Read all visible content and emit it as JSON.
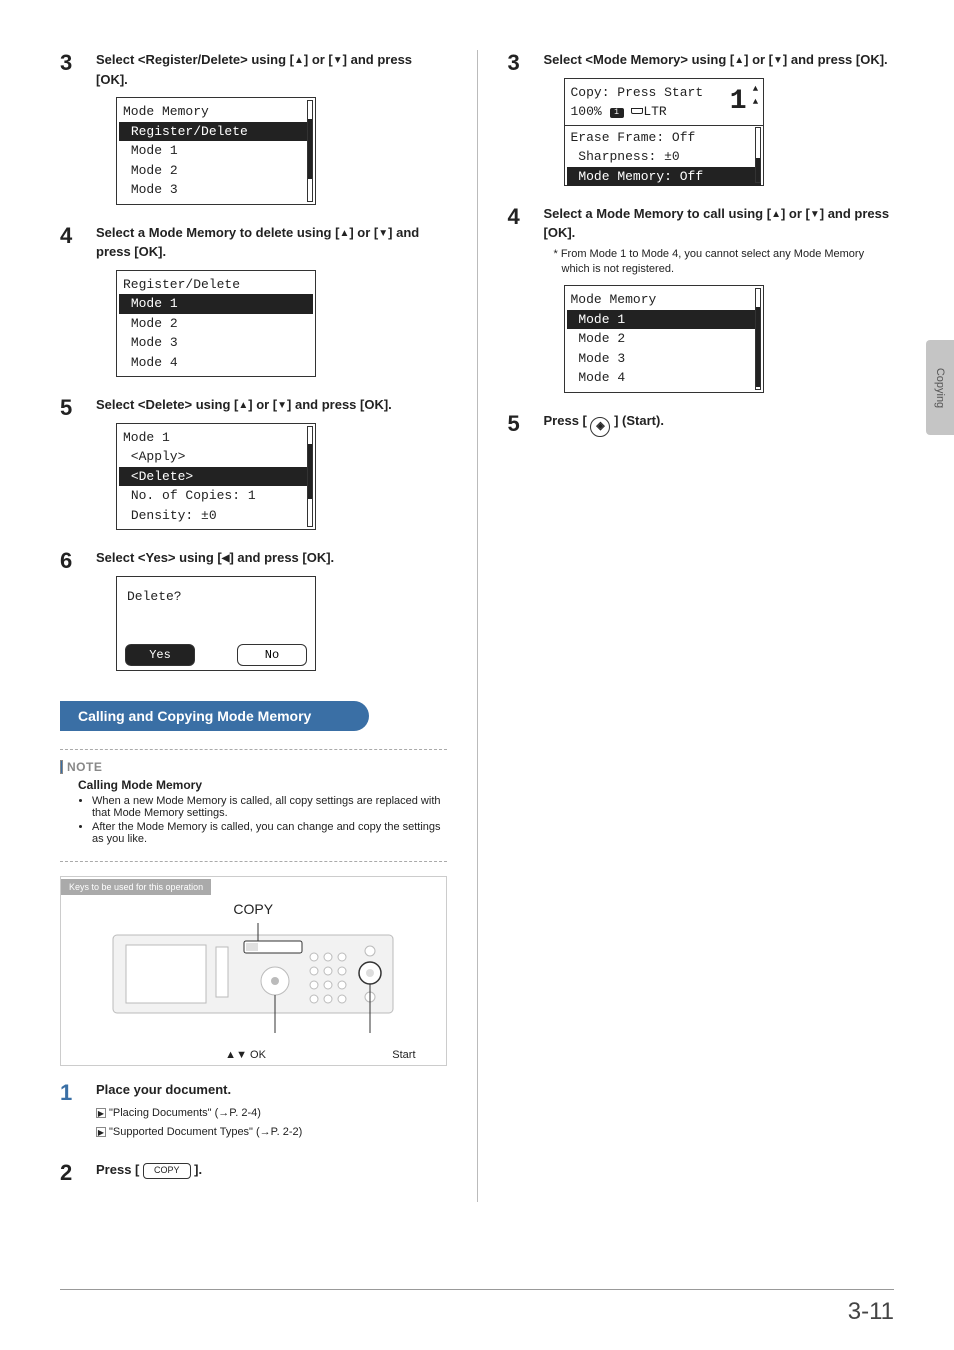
{
  "side_tab": "Copying",
  "footer_page": "3-11",
  "left": {
    "step3": {
      "text_a": "Select <Register/Delete> using [",
      "text_b": "] or [",
      "text_c": "] and press [OK].",
      "lcd": {
        "title": "Mode Memory",
        "sel": "Register/Delete",
        "r2": "Mode 1",
        "r3": "Mode 2",
        "r4": "Mode 3"
      }
    },
    "step4": {
      "text_a": "Select a Mode Memory to delete using [",
      "text_b": "] or [",
      "text_c": "] and press [OK].",
      "lcd": {
        "title": "Register/Delete",
        "sel": "Mode 1",
        "r2": "Mode 2",
        "r3": "Mode 3",
        "r4": "Mode 4"
      }
    },
    "step5": {
      "text_a": "Select <Delete> using [",
      "text_b": "] or [",
      "text_c": "] and press [OK].",
      "lcd": {
        "title": "Mode 1",
        "r1": " <Apply>",
        "sel": "<Delete>",
        "r3": "No. of Copies: 1",
        "r4": "Density: ±0"
      }
    },
    "step6": {
      "text_a": "Select <Yes> using [",
      "text_b": "] and press [OK].",
      "lcd": {
        "q": "Delete?",
        "yes": "Yes",
        "no": "No"
      }
    },
    "section_title": "Calling and Copying Mode Memory",
    "note": {
      "label": "NOTE",
      "subtitle": "Calling Mode Memory",
      "b1": "When a new Mode Memory is called, all copy settings are replaced with that Mode Memory settings.",
      "b2": "After the Mode Memory is called, you can change and copy the settings as you like."
    },
    "keys": {
      "tab": "Keys to be used for this operation",
      "title": "COPY",
      "label_ok": "▲▼ OK",
      "label_start": "Start"
    },
    "step1": {
      "text": "Place your document.",
      "ref1": "\"Placing Documents\" (→P. 2-4)",
      "ref2": "\"Supported Document Types\" (→P. 2-2)"
    },
    "step2": {
      "text_a": "Press [ ",
      "key": "COPY",
      "text_b": " ]."
    }
  },
  "right": {
    "step3": {
      "text_a": "Select <Mode Memory> using [",
      "text_b": "] or [",
      "text_c": "] and press [OK].",
      "lcd": {
        "l1": "Copy: Press Start",
        "l2a": "100% ",
        "l2paper": "1",
        "l2b": "LTR",
        "bignum": "1",
        "r2": "Erase Frame: Off",
        "r3": " Sharpness: ±0",
        "sel": "Mode Memory: Off"
      }
    },
    "step4": {
      "text_a": "Select a Mode Memory to call using [",
      "text_b": "] or [",
      "text_c": "] and press [OK].",
      "foot": "* From Mode 1 to Mode 4, you cannot select any Mode Memory which is not registered.",
      "lcd": {
        "title": "Mode Memory",
        "sel": "Mode 1",
        "r2": "Mode 2",
        "r3": "Mode 3",
        "r4": "Mode 4"
      }
    },
    "step5": {
      "text_a": "Press [ ",
      "text_b": " ] (Start)."
    }
  }
}
